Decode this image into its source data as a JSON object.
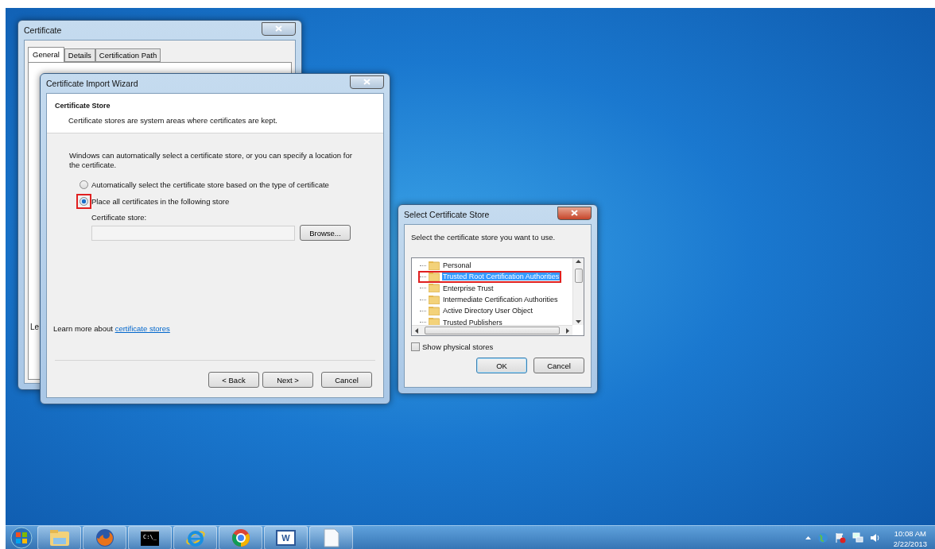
{
  "certificate_window": {
    "title": "Certificate",
    "tabs": [
      {
        "label": "General",
        "selected": true
      },
      {
        "label": "Details",
        "selected": false
      },
      {
        "label": "Certification Path",
        "selected": false
      }
    ],
    "partial_text": "Le"
  },
  "import_wizard": {
    "title": "Certificate Import Wizard",
    "header_title": "Certificate Store",
    "header_subtitle": "Certificate stores are system areas where certificates are kept.",
    "intro": "Windows can automatically select a certificate store, or you can specify a location for the certificate.",
    "options": [
      {
        "label": "Automatically select the certificate store based on the type of certificate",
        "selected": false,
        "highlighted": false
      },
      {
        "label": "Place all certificates in the following store",
        "selected": true,
        "highlighted": true
      }
    ],
    "store_label": "Certificate store:",
    "browse_button": "Browse...",
    "learn_more_text": "Learn more about",
    "learn_more_link": "certificate stores",
    "buttons": [
      "< Back",
      "Next >",
      "Cancel"
    ]
  },
  "select_store_dialog": {
    "title": "Select Certificate Store",
    "prompt": "Select the certificate store you want to use.",
    "items": [
      {
        "label": "Personal",
        "selected": false,
        "highlighted": false
      },
      {
        "label": "Trusted Root Certification Authorities",
        "selected": true,
        "highlighted": true
      },
      {
        "label": "Enterprise Trust",
        "selected": false,
        "highlighted": false
      },
      {
        "label": "Intermediate Certification Authorities",
        "selected": false,
        "highlighted": false
      },
      {
        "label": "Active Directory User Object",
        "selected": false,
        "highlighted": false
      },
      {
        "label": "Trusted Publishers",
        "selected": false,
        "highlighted": false
      }
    ],
    "show_physical_stores": {
      "label": "Show physical stores",
      "checked": false
    },
    "buttons": [
      "OK",
      "Cancel"
    ]
  },
  "taskbar": {
    "apps": [
      {
        "kind": "folder"
      },
      {
        "kind": "firefox"
      },
      {
        "kind": "console",
        "label": "C:\\_"
      },
      {
        "kind": "ie"
      },
      {
        "kind": "chrome"
      },
      {
        "kind": "word",
        "label": "W"
      },
      {
        "kind": "document"
      }
    ],
    "time": "10:08 AM",
    "date": "2/22/2013"
  }
}
